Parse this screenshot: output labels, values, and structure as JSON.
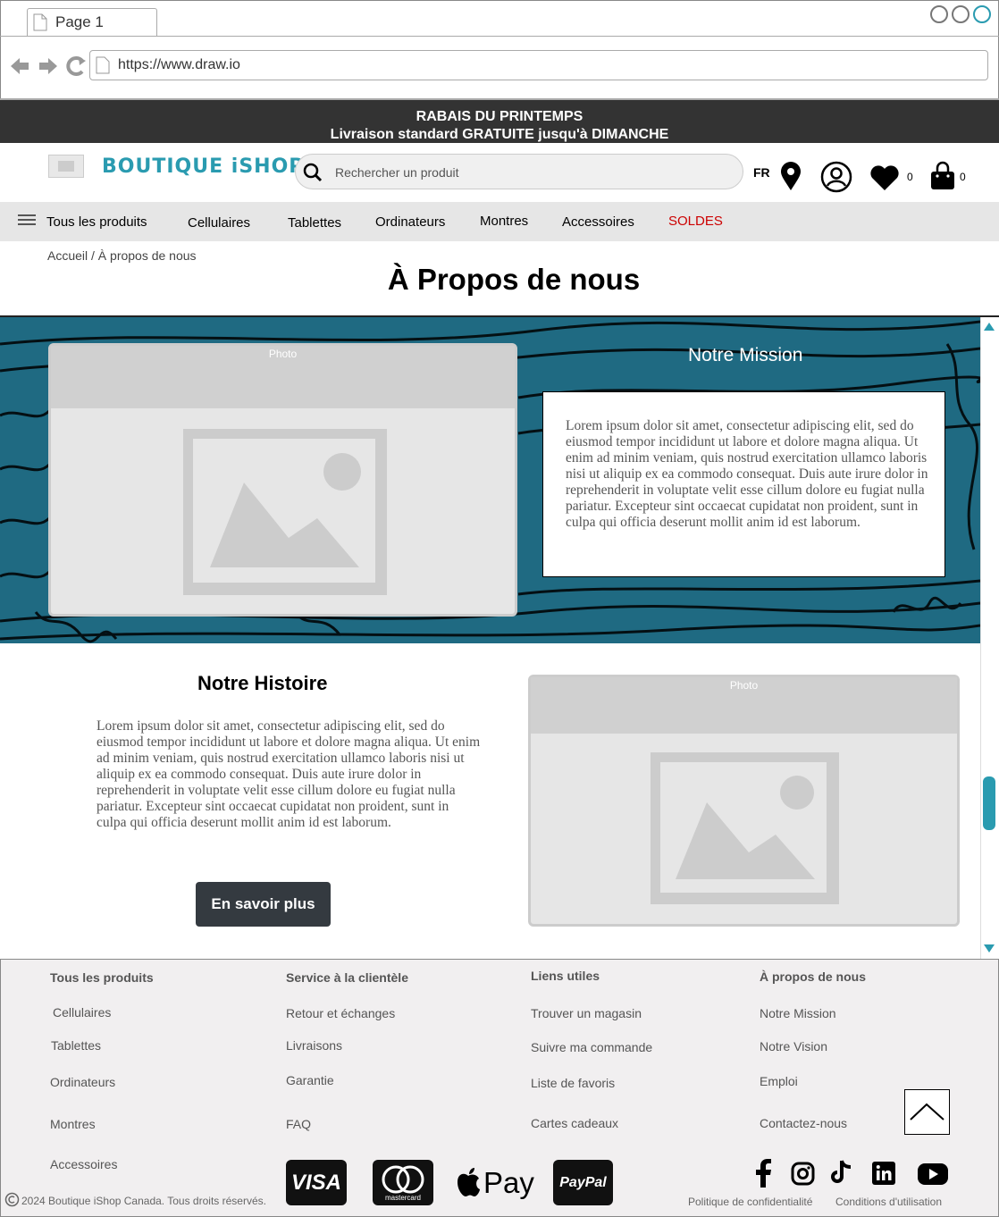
{
  "browser": {
    "tab_title": "Page 1",
    "url": "https://www.draw.io"
  },
  "promo": {
    "line1": "RABAIS DU PRINTEMPS",
    "line2": "Livraison standard GRATUITE jusqu'à DIMANCHE"
  },
  "header": {
    "logo_text": "BOUTIQUE iSHOP",
    "search_placeholder": "Rechercher un produit",
    "language": "FR",
    "wishlist_count": "0",
    "cart_count": "0"
  },
  "nav": {
    "all_products": "Tous les produits",
    "items": [
      "Cellulaires",
      "Tablettes",
      "Ordinateurs",
      "Montres",
      "Accessoires",
      "SOLDES"
    ],
    "sale_color": "#cc0000"
  },
  "breadcrumb": "Accueil / À propos de nous",
  "page_title": "À Propos de nous",
  "mission": {
    "photo_caption": "Photo",
    "title": "Notre Mission",
    "text": "Lorem ipsum dolor sit amet, consectetur adipiscing elit, sed do eiusmod tempor incididunt ut labore et dolore magna aliqua. Ut enim ad minim veniam, quis nostrud exercitation ullamco laboris nisi ut aliquip ex ea commodo consequat. Duis aute irure dolor in reprehenderit in voluptate velit esse cillum dolore eu fugiat nulla pariatur. Excepteur sint occaecat cupidatat non proident, sunt in culpa qui officia deserunt mollit anim id est laborum."
  },
  "history": {
    "title": "Notre Histoire",
    "text": "Lorem ipsum dolor sit amet, consectetur adipiscing elit, sed do eiusmod tempor incididunt ut labore et dolore magna aliqua. Ut enim ad minim veniam, quis nostrud exercitation ullamco laboris nisi ut aliquip ex ea commodo consequat. Duis aute irure dolor in reprehenderit in voluptate velit esse cillum dolore eu fugiat nulla pariatur. Excepteur sint occaecat cupidatat non proident, sunt in culpa qui officia deserunt mollit anim id est laborum.",
    "button": "En savoir plus",
    "photo_caption": "Photo"
  },
  "footer": {
    "col1": {
      "heading": "Tous les produits",
      "links": [
        "Cellulaires",
        "Tablettes",
        "Ordinateurs",
        "Montres",
        "Accessoires"
      ]
    },
    "col2": {
      "heading": "Service à la clientèle",
      "links": [
        "Retour et échanges",
        "Livraisons",
        "Garantie",
        "FAQ"
      ]
    },
    "col3": {
      "heading": "Liens utiles",
      "links": [
        "Trouver un magasin",
        "Suivre ma commande",
        "Liste de favoris",
        "Cartes cadeaux"
      ]
    },
    "col4": {
      "heading": "À propos de nous",
      "links": [
        "Notre Mission",
        "Notre Vision",
        "Emploi",
        "Contactez-nous"
      ]
    },
    "payments": {
      "visa": "VISA",
      "mastercard": "mastercard",
      "applepay": "Pay",
      "paypal": "PayPal"
    },
    "copyright": "2024 Boutique iShop Canada. Tous droits réservés.",
    "privacy": "Politique de confidentialité",
    "terms": "Conditions d'utilisation",
    "social_icons": [
      "facebook-icon",
      "instagram-icon",
      "tiktok-icon",
      "linkedin-icon",
      "youtube-icon"
    ]
  }
}
